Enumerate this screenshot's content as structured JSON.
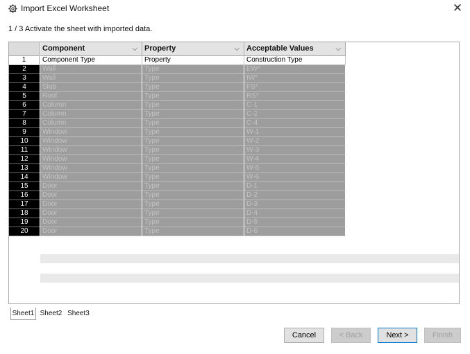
{
  "window": {
    "title": "Import Excel Worksheet",
    "close_label": "✕"
  },
  "step_text": "1 / 3 Activate the sheet with imported data.",
  "columns": [
    {
      "label": "Component"
    },
    {
      "label": "Property"
    },
    {
      "label": "Acceptable Values"
    }
  ],
  "column_chevron": "⌵",
  "rows": [
    {
      "num": "1",
      "cells": [
        "Component Type",
        "Property",
        "Construction Type"
      ]
    },
    {
      "num": "2",
      "cells": [
        "Wall",
        "Type",
        "EW*"
      ]
    },
    {
      "num": "3",
      "cells": [
        "Wall",
        "Type",
        "IW*"
      ]
    },
    {
      "num": "4",
      "cells": [
        "Slab",
        "Type",
        "FS*"
      ]
    },
    {
      "num": "5",
      "cells": [
        "Roof",
        "Type",
        "RS*"
      ]
    },
    {
      "num": "6",
      "cells": [
        "Column",
        "Type",
        "C-1"
      ]
    },
    {
      "num": "7",
      "cells": [
        "Column",
        "Type",
        "C-2"
      ]
    },
    {
      "num": "8",
      "cells": [
        "Column",
        "Type",
        "C-4"
      ]
    },
    {
      "num": "9",
      "cells": [
        "Window",
        "Type",
        "W-1"
      ]
    },
    {
      "num": "10",
      "cells": [
        "Window",
        "Type",
        "W-2"
      ]
    },
    {
      "num": "11",
      "cells": [
        "Window",
        "Type",
        "W-3"
      ]
    },
    {
      "num": "12",
      "cells": [
        "Window",
        "Type",
        "W-4"
      ]
    },
    {
      "num": "13",
      "cells": [
        "Window",
        "Type",
        "W-5"
      ]
    },
    {
      "num": "14",
      "cells": [
        "Window",
        "Type",
        "W-6"
      ]
    },
    {
      "num": "15",
      "cells": [
        "Door",
        "Type",
        "D-1"
      ]
    },
    {
      "num": "16",
      "cells": [
        "Door",
        "Type",
        "D-2"
      ]
    },
    {
      "num": "17",
      "cells": [
        "Door",
        "Type",
        "D-3"
      ]
    },
    {
      "num": "18",
      "cells": [
        "Door",
        "Type",
        "D-4"
      ]
    },
    {
      "num": "19",
      "cells": [
        "Door",
        "Type",
        "D-5"
      ]
    },
    {
      "num": "20",
      "cells": [
        "Door",
        "Type",
        "D-6"
      ]
    }
  ],
  "sheet_tabs": [
    {
      "label": "Sheet1",
      "active": true
    },
    {
      "label": "Sheet2",
      "active": false
    },
    {
      "label": "Sheet3",
      "active": false
    }
  ],
  "buttons": {
    "cancel": {
      "label": "Cancel",
      "enabled": true
    },
    "back": {
      "label": "< Back",
      "enabled": false
    },
    "next": {
      "label": "Next >",
      "enabled": true
    },
    "finish": {
      "label": "Finish",
      "enabled": false
    }
  },
  "icons": {
    "title": "gear-icon",
    "close": "close-icon",
    "column_dropdown": "chevron-down-icon"
  },
  "colors": {
    "row_number_bg": "#000000",
    "selected_cell_bg": "#9d9d9d",
    "tab_border": "#9a9a9a"
  }
}
